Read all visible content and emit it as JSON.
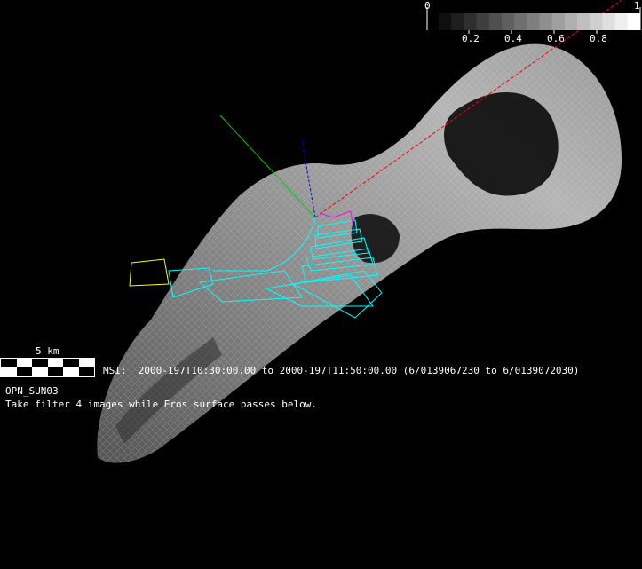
{
  "colorbar": {
    "min_label": "0",
    "max_label": "1",
    "tick_labels": [
      "0.2",
      "0.4",
      "0.6",
      "0.8"
    ],
    "steps": 16
  },
  "scale_bar": {
    "label": "5 km"
  },
  "msi_line": "MSI:  2000-197T10:30:00.00 to 2000-197T11:50:00.00 (6/0139067230 to 6/0139072030)",
  "observation_name": "OPN_SUN03",
  "observation_description": "Take filter 4 images while Eros surface passes below.",
  "colors": {
    "sun_vector": "#ff0000",
    "axis_green": "#00cc00",
    "axis_blue": "#0000ff",
    "footprints": "#00ffff",
    "current_footprint": "#ffff00",
    "track": "#ff00ff"
  }
}
